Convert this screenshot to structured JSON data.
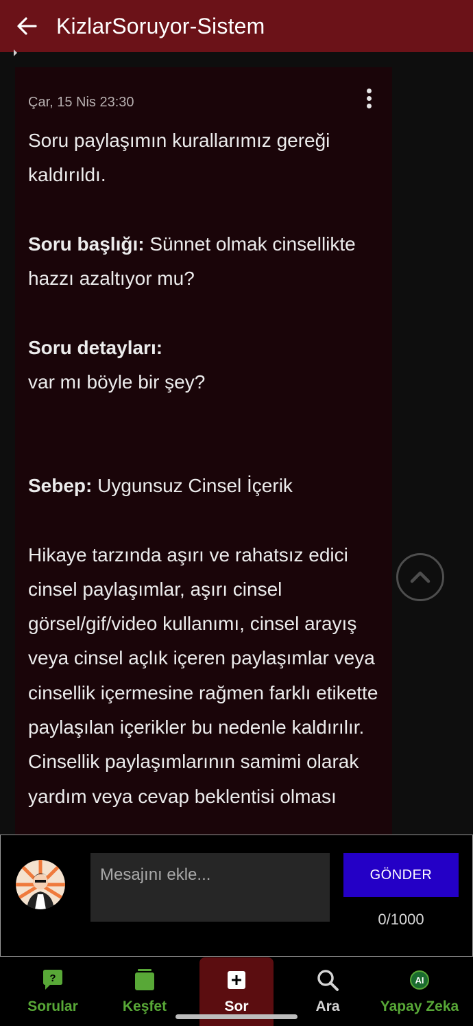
{
  "header": {
    "title": "KizlarSoruyor-Sistem",
    "back_icon": "arrow-left-icon"
  },
  "message": {
    "timestamp": "Çar, 15 Nis 23:30",
    "intro": "Soru paylaşımın kurallarımız gereği kaldırıldı.",
    "title_label": "Soru başlığı:",
    "title_value": "Sünnet olmak cinsellikte hazzı azaltıyor mu?",
    "details_label": "Soru detayları:",
    "details_value": "var mı böyle bir şey?",
    "reason_label": "Sebep:",
    "reason_value": "Uygunsuz Cinsel İçerik",
    "explanation": "Hikaye tarzında aşırı ve rahatsız edici cinsel paylaşımlar, aşırı cinsel görsel/gif/video kullanımı, cinsel arayış veya cinsel açlık içeren paylaşımlar veya cinsellik içermesine rağmen farklı etikette paylaşılan içerikler bu nedenle kaldırılır. Cinsellik paylaşımlarının samimi olarak yardım veya cevap beklentisi olması"
  },
  "compose": {
    "placeholder": "Mesajını ekle...",
    "send_label": "GÖNDER",
    "counter": "0/1000"
  },
  "nav": [
    {
      "label": "Sorular",
      "icon": "question-bubble-icon"
    },
    {
      "label": "Keşfet",
      "icon": "cards-icon"
    },
    {
      "label": "Sor",
      "icon": "plus-square-icon"
    },
    {
      "label": "Ara",
      "icon": "search-icon"
    },
    {
      "label": "Yapay Zeka",
      "icon": "ai-icon"
    }
  ],
  "colors": {
    "header_bg": "#6b1218",
    "card_bg": "#1a0509",
    "nav_green": "#58a837",
    "send_button": "#2400c6",
    "active_nav_bg": "#5b0d10"
  }
}
